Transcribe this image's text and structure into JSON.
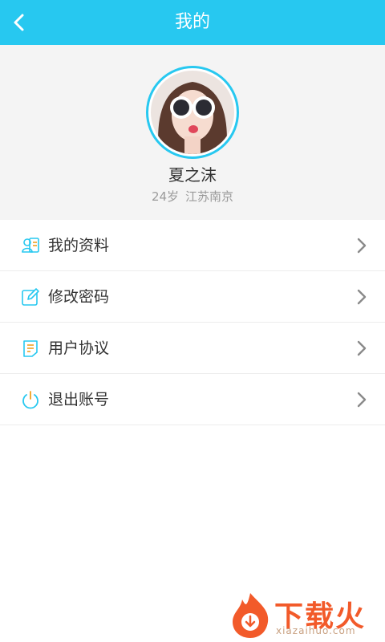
{
  "header": {
    "title": "我的",
    "back_icon": "chevron-left-icon",
    "background_color": "#27c8f0"
  },
  "profile": {
    "name": "夏之沫",
    "age": "24岁",
    "location": "江苏南京",
    "avatar_ring_color": "#27c8f0"
  },
  "menu": {
    "items": [
      {
        "label": "我的资料",
        "icon": "profile-card-icon"
      },
      {
        "label": "修改密码",
        "icon": "edit-icon"
      },
      {
        "label": "用户协议",
        "icon": "document-icon"
      },
      {
        "label": "退出账号",
        "icon": "power-icon"
      }
    ],
    "chevron_icon": "chevron-right-icon"
  },
  "watermark": {
    "text": "下载火",
    "subtext": "xiazaihuo.com"
  }
}
